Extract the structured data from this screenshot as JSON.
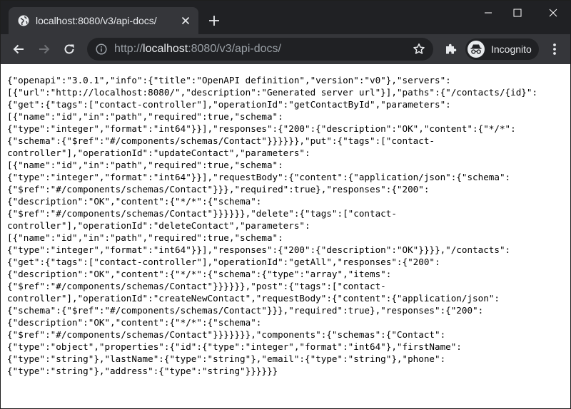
{
  "window": {
    "tab_title": "localhost:8080/v3/api-docs/",
    "minimize_icon": "minimize-icon",
    "maximize_icon": "maximize-icon",
    "close_icon": "close-icon"
  },
  "toolbar": {
    "url_scheme": "http://",
    "url_host": "localhost",
    "url_rest": ":8080/v3/api-docs/",
    "profile_label": "Incognito"
  },
  "colors": {
    "titlebar": "#202124",
    "toolbar": "#35363a",
    "omnibox": "#202124",
    "text_light": "#e8eaed",
    "text_dim": "#9aa0a6",
    "page_background": "#ffffff"
  },
  "page": {
    "lines": [
      "{\"openapi\":\"3.0.1\",\"info\":{\"title\":\"OpenAPI definition\",\"version\":\"v0\"},\"servers\":",
      "[{\"url\":\"http://localhost:8080/\",\"description\":\"Generated server url\"}],\"paths\":{\"/contacts/{id}\":",
      "{\"get\":{\"tags\":[\"contact-controller\"],\"operationId\":\"getContactById\",\"parameters\":",
      "[{\"name\":\"id\",\"in\":\"path\",\"required\":true,\"schema\":",
      "{\"type\":\"integer\",\"format\":\"int64\"}}],\"responses\":{\"200\":{\"description\":\"OK\",\"content\":{\"*/*\":",
      "{\"schema\":{\"$ref\":\"#/components/schemas/Contact\"}}}}}},\"put\":{\"tags\":[\"contact-",
      "controller\"],\"operationId\":\"updateContact\",\"parameters\":",
      "[{\"name\":\"id\",\"in\":\"path\",\"required\":true,\"schema\":",
      "{\"type\":\"integer\",\"format\":\"int64\"}}],\"requestBody\":{\"content\":{\"application/json\":{\"schema\":",
      "{\"$ref\":\"#/components/schemas/Contact\"}}},\"required\":true},\"responses\":{\"200\":",
      "{\"description\":\"OK\",\"content\":{\"*/*\":{\"schema\":",
      "{\"$ref\":\"#/components/schemas/Contact\"}}}}}},\"delete\":{\"tags\":[\"contact-",
      "controller\"],\"operationId\":\"deleteContact\",\"parameters\":",
      "[{\"name\":\"id\",\"in\":\"path\",\"required\":true,\"schema\":",
      "{\"type\":\"integer\",\"format\":\"int64\"}}],\"responses\":{\"200\":{\"description\":\"OK\"}}}},\"/contacts\":",
      "{\"get\":{\"tags\":[\"contact-controller\"],\"operationId\":\"getAll\",\"responses\":{\"200\":",
      "{\"description\":\"OK\",\"content\":{\"*/*\":{\"schema\":{\"type\":\"array\",\"items\":",
      "{\"$ref\":\"#/components/schemas/Contact\"}}}}}},\"post\":{\"tags\":[\"contact-",
      "controller\"],\"operationId\":\"createNewContact\",\"requestBody\":{\"content\":{\"application/json\":",
      "{\"schema\":{\"$ref\":\"#/components/schemas/Contact\"}}},\"required\":true},\"responses\":{\"200\":",
      "{\"description\":\"OK\",\"content\":{\"*/*\":{\"schema\":",
      "{\"$ref\":\"#/components/schemas/Contact\"}}}}}}},\"components\":{\"schemas\":{\"Contact\":",
      "{\"type\":\"object\",\"properties\":{\"id\":{\"type\":\"integer\",\"format\":\"int64\"},\"firstName\":",
      "{\"type\":\"string\"},\"lastName\":{\"type\":\"string\"},\"email\":{\"type\":\"string\"},\"phone\":",
      "{\"type\":\"string\"},\"address\":{\"type\":\"string\"}}}}}}"
    ]
  }
}
